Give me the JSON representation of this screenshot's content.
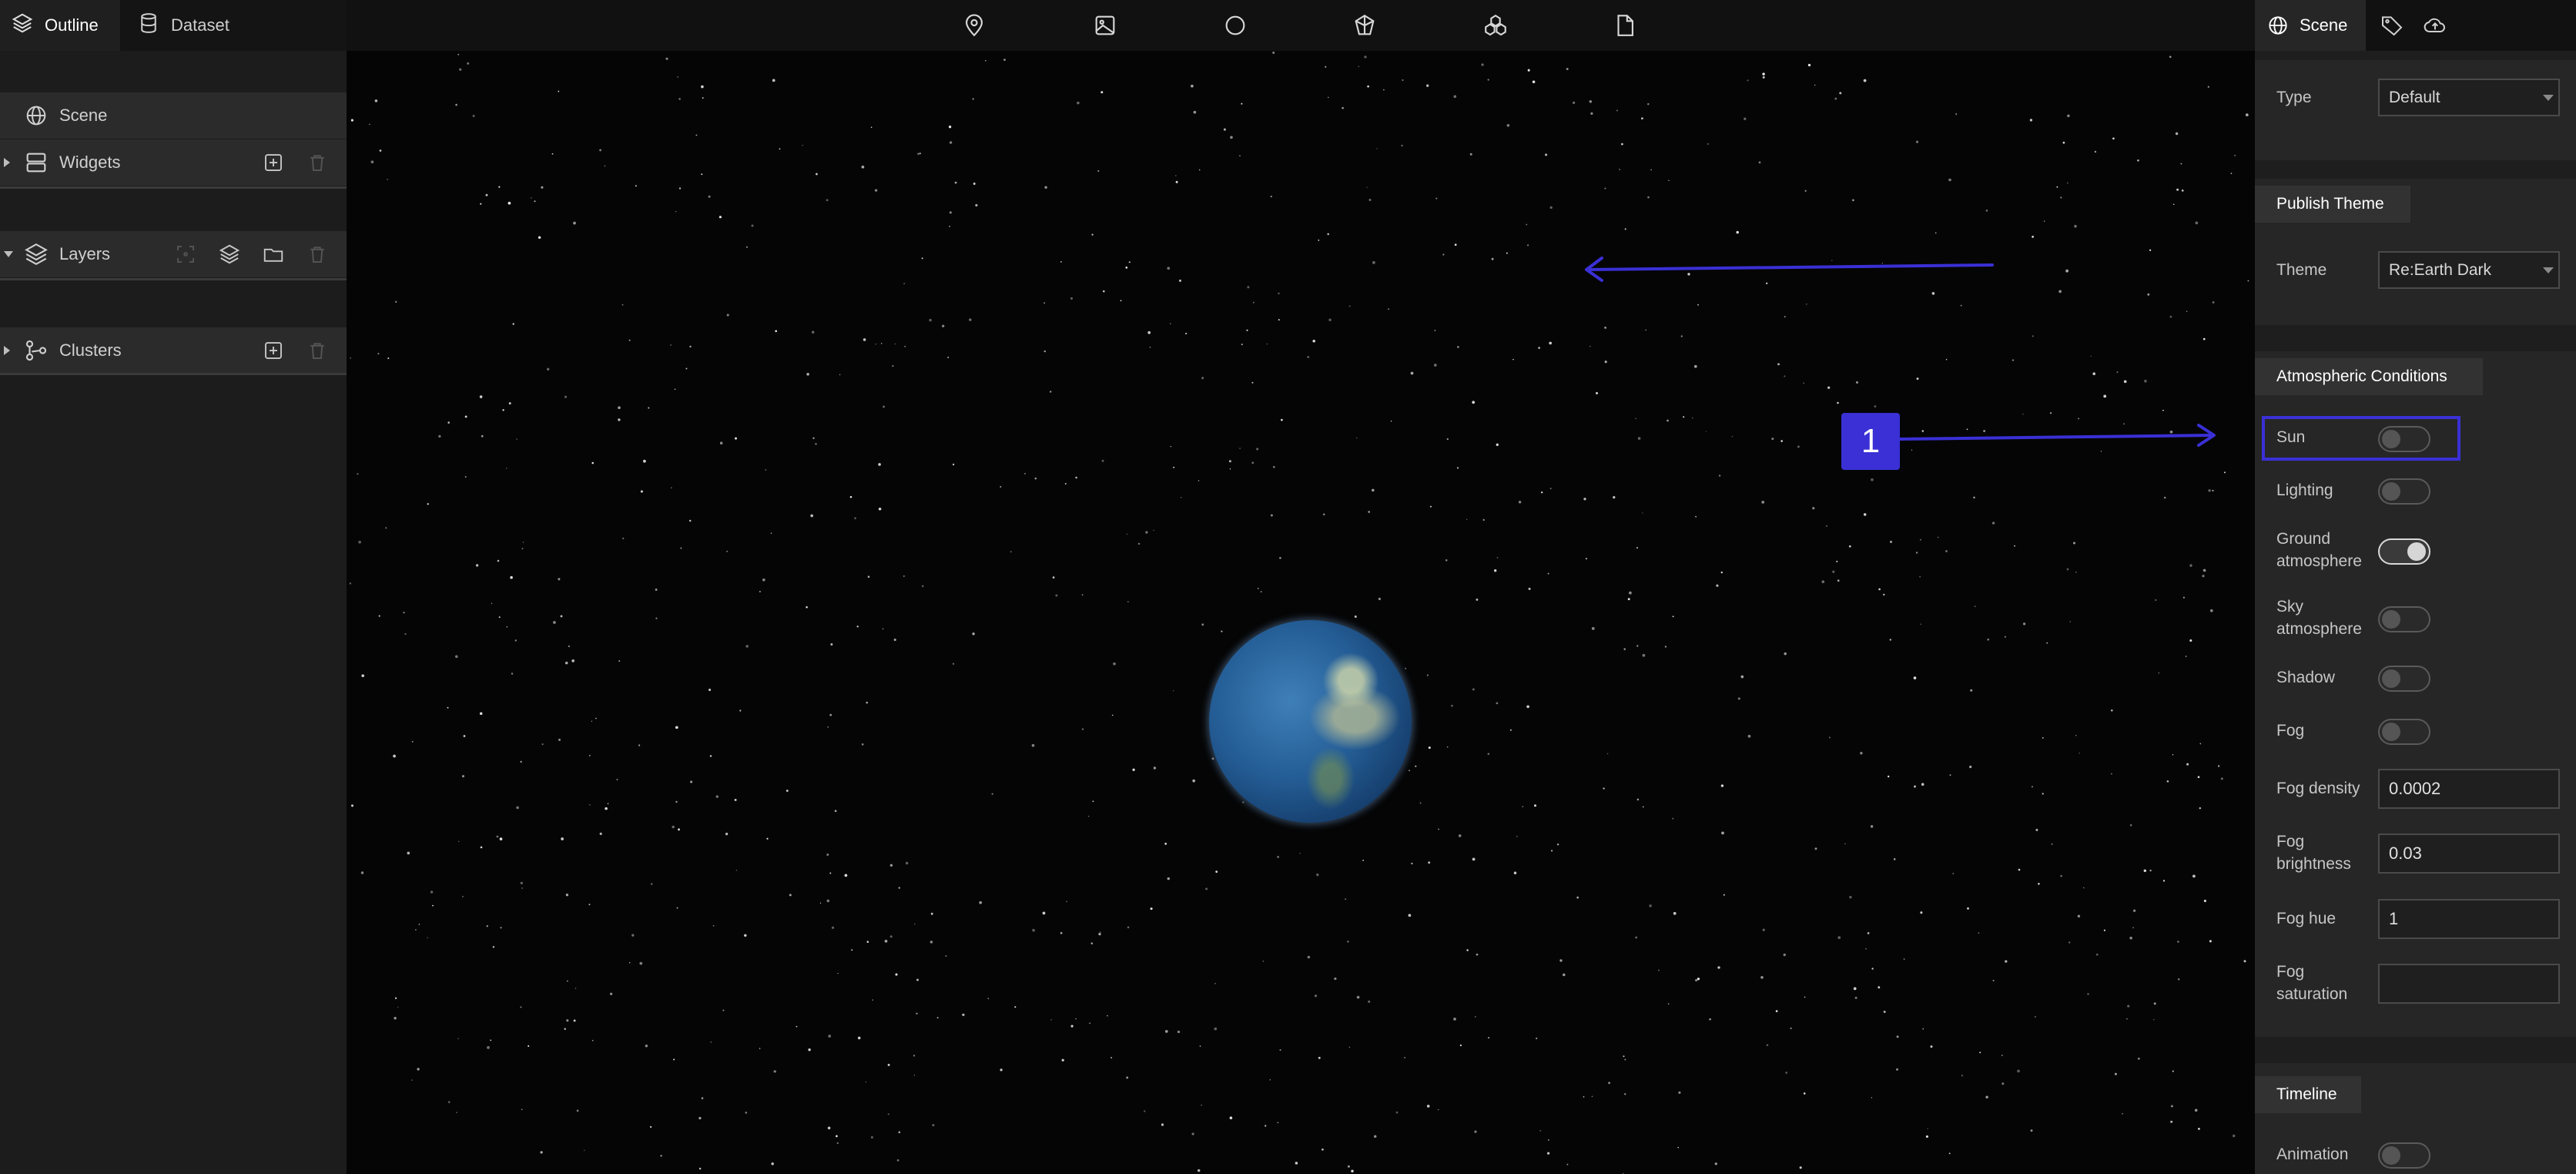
{
  "left_panel": {
    "tabs": [
      {
        "label": "Outline",
        "icon": "layers-icon",
        "active": true
      },
      {
        "label": "Dataset",
        "icon": "database-icon",
        "active": false
      }
    ],
    "rows": {
      "scene": {
        "label": "Scene",
        "icon": "globe-icon"
      },
      "widgets": {
        "label": "Widgets",
        "icon": "widgets-icon",
        "actions": [
          "add-icon",
          "trash-icon"
        ]
      },
      "layers": {
        "label": "Layers",
        "icon": "layers-icon",
        "actions": [
          "select-icon",
          "layers-add-icon",
          "folder-icon",
          "trash-icon"
        ]
      },
      "clusters": {
        "label": "Clusters",
        "icon": "cluster-icon",
        "actions": [
          "add-icon",
          "trash-icon"
        ]
      }
    }
  },
  "toolbar": {
    "tools": [
      "map-pin-icon",
      "image-icon",
      "circle-icon",
      "polygon-3d-icon",
      "model-icon",
      "file-icon"
    ]
  },
  "right_panel": {
    "tabs": [
      {
        "label": "Scene",
        "icon": "globe-icon",
        "active": true
      },
      {
        "label": "",
        "icon": "tag-icon",
        "active": false
      },
      {
        "label": "",
        "icon": "publish-icon",
        "active": false
      }
    ],
    "type_field": {
      "label": "Type",
      "value": "Default"
    },
    "publish_theme": {
      "title": "Publish Theme",
      "theme": {
        "label": "Theme",
        "value": "Re:Earth Dark"
      }
    },
    "atmospheric": {
      "title": "Atmospheric Conditions",
      "sun": {
        "label": "Sun",
        "on": false
      },
      "lighting": {
        "label": "Lighting",
        "on": false
      },
      "ground_atmosphere": {
        "label_line1": "Ground",
        "label_line2": "atmosphere",
        "on": true
      },
      "sky_atmosphere": {
        "label_line1": "Sky",
        "label_line2": "atmosphere",
        "on": false
      },
      "shadow": {
        "label": "Shadow",
        "on": false
      },
      "fog": {
        "label": "Fog",
        "on": false
      },
      "fog_density": {
        "label": "Fog density",
        "value": "0.0002"
      },
      "fog_brightness": {
        "label_line1": "Fog",
        "label_line2": "brightness",
        "value": "0.03"
      },
      "fog_hue": {
        "label": "Fog hue",
        "value": "1"
      },
      "fog_saturation": {
        "label_line1": "Fog",
        "label_line2": "saturation",
        "value": ""
      }
    },
    "timeline": {
      "title": "Timeline",
      "animation": {
        "label": "Animation",
        "on": false
      }
    }
  },
  "annotation": {
    "marker_label": "1",
    "color": "#3a30d6"
  },
  "colors": {
    "panel_bg": "#1c1c1c",
    "viewport_bg": "#050505",
    "accent": "#3a30d6"
  }
}
